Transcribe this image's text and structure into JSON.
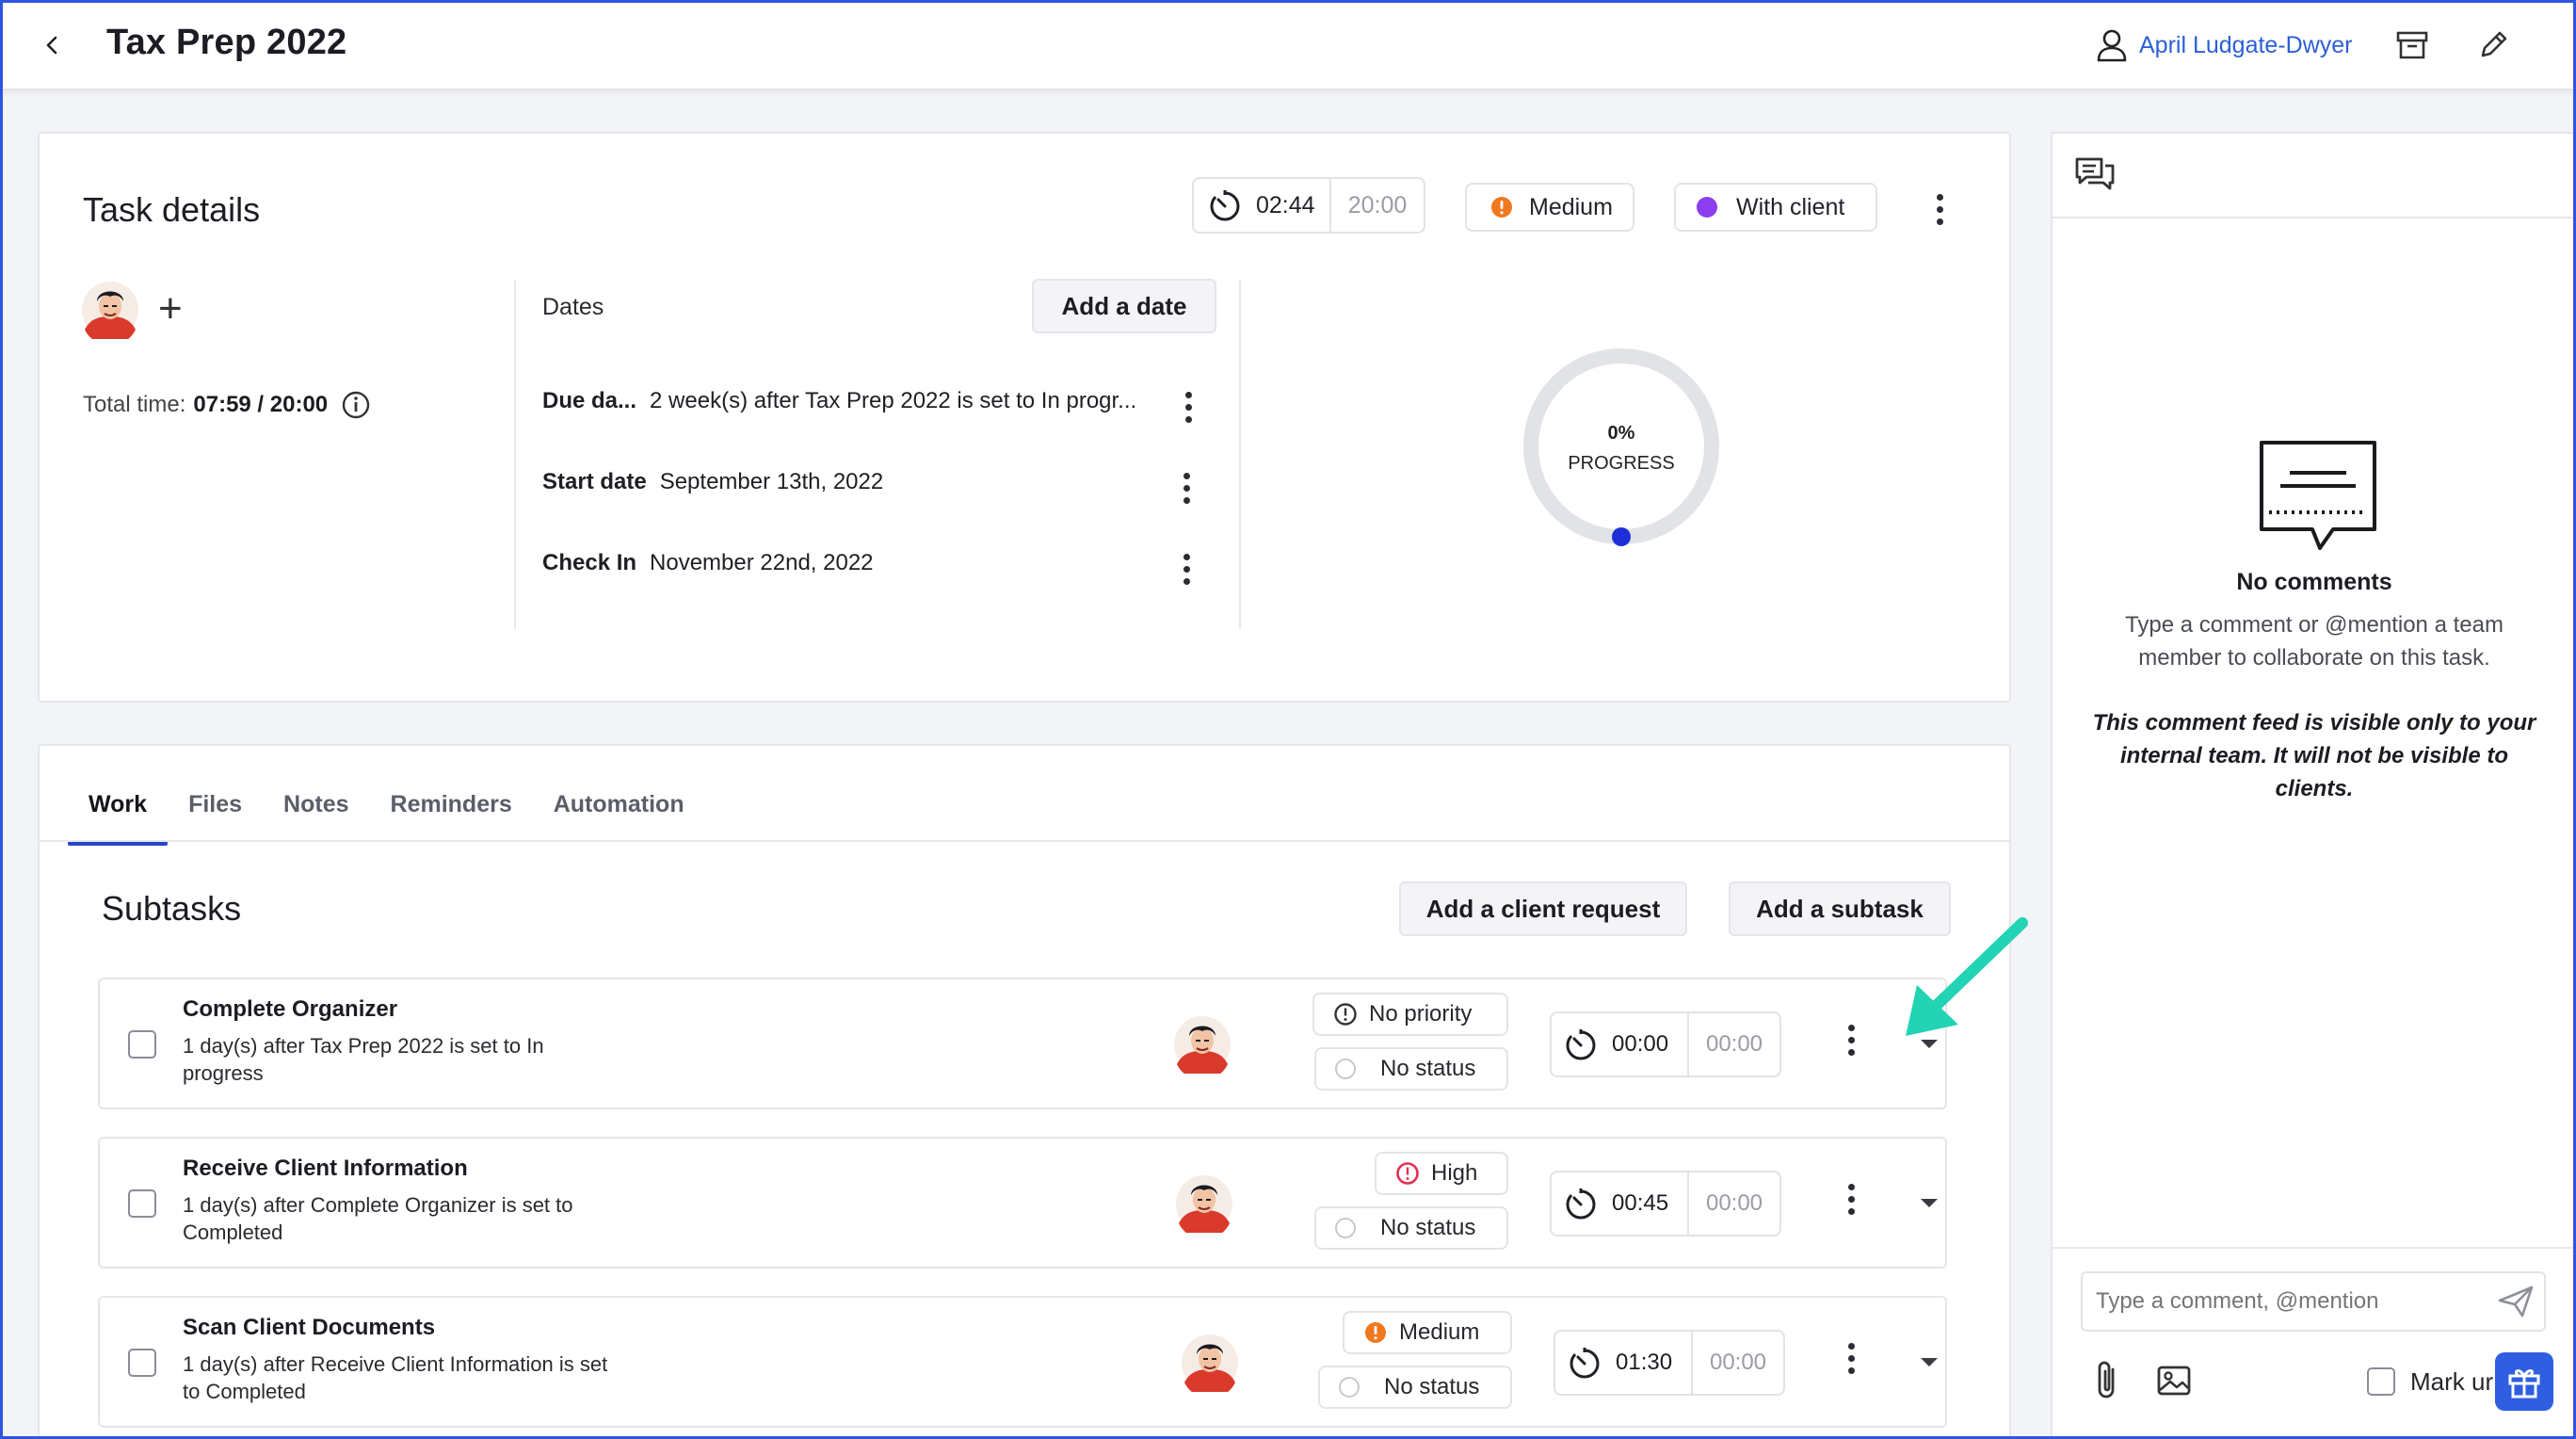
{
  "header": {
    "title": "Tax Prep 2022",
    "user_name": "April Ludgate-Dwyer"
  },
  "task": {
    "section_title": "Task details",
    "timer": {
      "elapsed": "02:44",
      "budget": "20:00"
    },
    "priority": "Medium",
    "status": "With client",
    "status_color": "#8b3ff0",
    "priority_color": "#f0781e",
    "total_time_label": "Total time:",
    "total_time_value": "07:59 / 20:00",
    "dates_label": "Dates",
    "add_date_label": "Add a date",
    "dates": [
      {
        "label": "Due da...",
        "value": "2 week(s) after Tax Prep 2022 is set to In progr..."
      },
      {
        "label": "Start date",
        "value": "September 13th, 2022"
      },
      {
        "label": "Check In",
        "value": "November 22nd, 2022"
      }
    ],
    "progress": {
      "percent_text": "0%",
      "label": "PROGRESS",
      "value": 0
    }
  },
  "work": {
    "tabs": [
      "Work",
      "Files",
      "Notes",
      "Reminders",
      "Automation"
    ],
    "active_tab": "Work",
    "subtasks_title": "Subtasks",
    "add_client_request_label": "Add a client request",
    "add_subtask_label": "Add a subtask",
    "subtasks": [
      {
        "title": "Complete Organizer",
        "desc": "1 day(s) after Tax Prep 2022 is set to In progress",
        "priority": "No priority",
        "status": "No status",
        "elapsed": "00:00",
        "budget": "00:00"
      },
      {
        "title": "Receive Client Information",
        "desc": "1 day(s) after Complete Organizer is set to Completed",
        "priority": "High",
        "status": "No status",
        "elapsed": "00:45",
        "budget": "00:00"
      },
      {
        "title": "Scan Client Documents",
        "desc": "1 day(s) after Receive Client Information is set to Completed",
        "priority": "Medium",
        "status": "No status",
        "elapsed": "01:30",
        "budget": "00:00"
      }
    ]
  },
  "comments": {
    "empty_title": "No comments",
    "empty_sub": "Type a comment or @mention a team member to collaborate on this task.",
    "empty_note": "This comment feed is visible only to your internal team. It will not be visible to clients.",
    "input_placeholder": "Type a comment, @mention",
    "mark_label": "Mark ur"
  },
  "colors": {
    "accent": "#2847c9",
    "link": "#2c5fd6",
    "annotation_arrow": "#22d3b4",
    "high_priority": "#e5304f"
  }
}
